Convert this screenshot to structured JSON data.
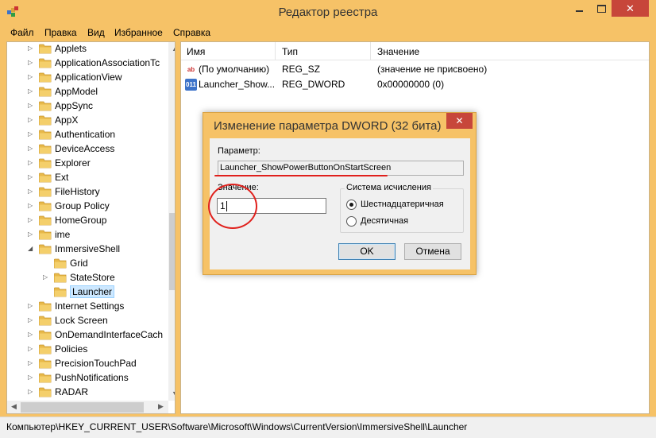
{
  "window": {
    "title": "Редактор реестра",
    "close_glyph": "✕"
  },
  "menu": [
    "Файл",
    "Правка",
    "Вид",
    "Избранное",
    "Справка"
  ],
  "tree": {
    "items": [
      {
        "label": "Applets",
        "level": 1,
        "expander": "▷"
      },
      {
        "label": "ApplicationAssociationTc",
        "level": 1,
        "expander": "▷"
      },
      {
        "label": "ApplicationView",
        "level": 1,
        "expander": "▷"
      },
      {
        "label": "AppModel",
        "level": 1,
        "expander": "▷"
      },
      {
        "label": "AppSync",
        "level": 1,
        "expander": "▷"
      },
      {
        "label": "AppX",
        "level": 1,
        "expander": "▷"
      },
      {
        "label": "Authentication",
        "level": 1,
        "expander": "▷"
      },
      {
        "label": "DeviceAccess",
        "level": 1,
        "expander": "▷"
      },
      {
        "label": "Explorer",
        "level": 1,
        "expander": "▷"
      },
      {
        "label": "Ext",
        "level": 1,
        "expander": "▷"
      },
      {
        "label": "FileHistory",
        "level": 1,
        "expander": "▷"
      },
      {
        "label": "Group Policy",
        "level": 1,
        "expander": "▷"
      },
      {
        "label": "HomeGroup",
        "level": 1,
        "expander": "▷"
      },
      {
        "label": "ime",
        "level": 1,
        "expander": "▷"
      },
      {
        "label": "ImmersiveShell",
        "level": 1,
        "expander": "◢"
      },
      {
        "label": "Grid",
        "level": 2,
        "expander": ""
      },
      {
        "label": "StateStore",
        "level": 2,
        "expander": "▷"
      },
      {
        "label": "Launcher",
        "level": 2,
        "expander": "",
        "selected": true
      },
      {
        "label": "Internet Settings",
        "level": 1,
        "expander": "▷"
      },
      {
        "label": "Lock Screen",
        "level": 1,
        "expander": "▷"
      },
      {
        "label": "OnDemandInterfaceCach",
        "level": 1,
        "expander": "▷"
      },
      {
        "label": "Policies",
        "level": 1,
        "expander": "▷"
      },
      {
        "label": "PrecisionTouchPad",
        "level": 1,
        "expander": "▷"
      },
      {
        "label": "PushNotifications",
        "level": 1,
        "expander": "▷"
      },
      {
        "label": "RADAR",
        "level": 1,
        "expander": "▷"
      }
    ]
  },
  "list": {
    "columns": [
      "Имя",
      "Тип",
      "Значение"
    ],
    "rows": [
      {
        "icon": "ab",
        "name": "(По умолчанию)",
        "type": "REG_SZ",
        "value": "(значение не присвоено)"
      },
      {
        "icon": "011",
        "name": "Launcher_Show...",
        "type": "REG_DWORD",
        "value": "0x00000000 (0)"
      }
    ]
  },
  "status": {
    "path": "Компьютер\\HKEY_CURRENT_USER\\Software\\Microsoft\\Windows\\CurrentVersion\\ImmersiveShell\\Launcher"
  },
  "dialog": {
    "title": "Изменение параметра DWORD (32 бита)",
    "close_glyph": "✕",
    "param_label": "Параметр:",
    "param_value": "Launcher_ShowPowerButtonOnStartScreen",
    "value_label": "Значение:",
    "value_input": "1",
    "base_group_title": "Система исчисления",
    "base_options": [
      {
        "label": "Шестнадцатеричная",
        "selected": true
      },
      {
        "label": "Десятичная",
        "selected": false
      }
    ],
    "ok_label": "OK",
    "cancel_label": "Отмена"
  },
  "colors": {
    "frame": "#f6c267",
    "close_button": "#c7463a",
    "annotation_red": "#e0201c",
    "selection": "#cde8ff"
  },
  "icons": [
    "regedit-app-icon",
    "folder-icon",
    "reg-sz-icon",
    "reg-dword-icon"
  ]
}
